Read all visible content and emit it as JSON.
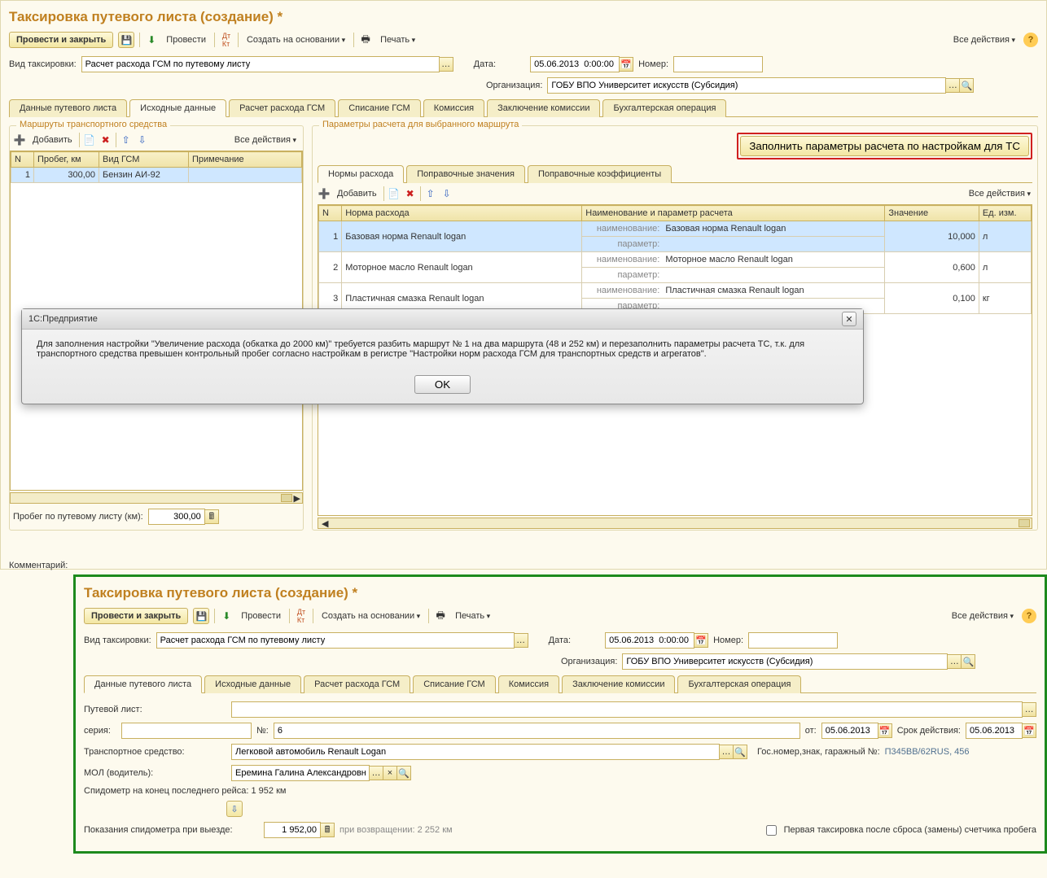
{
  "top": {
    "title": "Таксировка путевого листа (создание) *",
    "toolbar": {
      "post_close": "Провести и закрыть",
      "post": "Провести",
      "create_based": "Создать на основании",
      "print": "Печать",
      "all_actions": "Все действия"
    },
    "fields": {
      "type_label": "Вид таксировки:",
      "type_value": "Расчет расхода ГСМ по путевому листу",
      "date_label": "Дата:",
      "date_value": "05.06.2013  0:00:00",
      "number_label": "Номер:",
      "number_value": "",
      "org_label": "Организация:",
      "org_value": "ГОБУ ВПО Университет искусств (Субсидия)"
    },
    "tabs": [
      "Данные путевого листа",
      "Исходные данные",
      "Расчет расхода ГСМ",
      "Списание ГСМ",
      "Комиссия",
      "Заключение комиссии",
      "Бухгалтерская операция"
    ],
    "active_tab": 1,
    "left_panel": {
      "legend": "Маршруты транспортного средства",
      "toolbar": {
        "add": "Добавить",
        "all_actions": "Все действия"
      },
      "cols": [
        "N",
        "Пробег, км",
        "Вид ГСМ",
        "Примечание"
      ],
      "rows": [
        {
          "n": "1",
          "probeg": "300,00",
          "gsm": "Бензин АИ-92",
          "note": ""
        }
      ]
    },
    "right_panel": {
      "legend": "Параметры расчета для выбранного маршрута",
      "fill_btn": "Заполнить параметры расчета по настройкам для ТС",
      "subtabs": [
        "Нормы расхода",
        "Поправочные значения",
        "Поправочные коэффициенты"
      ],
      "active_subtab": 0,
      "toolbar": {
        "add": "Добавить",
        "all_actions": "Все действия"
      },
      "cols": [
        "N",
        "Норма расхода",
        "Наименование и параметр расчета",
        "Значение",
        "Ед. изм."
      ],
      "rows": [
        {
          "n": "1",
          "norm": "Базовая норма Renault logan",
          "name_lbl": "наименование:",
          "name_val": "Базовая норма Renault logan",
          "param_lbl": "параметр:",
          "param_val": "",
          "value": "10,000",
          "unit": "л"
        },
        {
          "n": "2",
          "norm": "Моторное масло Renault logan",
          "name_lbl": "наименование:",
          "name_val": "Моторное масло Renault logan",
          "param_lbl": "параметр:",
          "param_val": "",
          "value": "0,600",
          "unit": "л"
        },
        {
          "n": "3",
          "norm": "Пластичная смазка Renault logan",
          "name_lbl": "наименование:",
          "name_val": "Пластичная смазка Renault logan",
          "param_lbl": "параметр:",
          "param_val": "",
          "value": "0,100",
          "unit": "кг"
        }
      ]
    },
    "footer": {
      "probeg_label": "Пробег по путевому листу (км):",
      "probeg_value": "300,00"
    },
    "dialog": {
      "title": "1С:Предприятие",
      "text": "Для заполнения настройки \"Увеличение расхода (обкатка до 2000 км)\" требуется разбить маршрут № 1 на два маршрута (48 и 252 км) и перезаполнить параметры расчета ТС, т.к. для транспортного средства превышен контрольный пробег согласно настройкам в регистре \"Настройки норм расхода ГСМ для транспортных средств и агрегатов\".",
      "ok": "OK"
    },
    "comment_label": "Комментарий:"
  },
  "bottom": {
    "title": "Таксировка путевого листа (создание) *",
    "toolbar": {
      "post_close": "Провести и закрыть",
      "post": "Провести",
      "create_based": "Создать на основании",
      "print": "Печать",
      "all_actions": "Все действия"
    },
    "fields": {
      "type_label": "Вид таксировки:",
      "type_value": "Расчет расхода ГСМ по путевому листу",
      "date_label": "Дата:",
      "date_value": "05.06.2013  0:00:00",
      "number_label": "Номер:",
      "number_value": "",
      "org_label": "Организация:",
      "org_value": "ГОБУ ВПО Университет искусств (Субсидия)"
    },
    "tabs": [
      "Данные путевого листа",
      "Исходные данные",
      "Расчет расхода ГСМ",
      "Списание ГСМ",
      "Комиссия",
      "Заключение комиссии",
      "Бухгалтерская операция"
    ],
    "active_tab": 0,
    "waybill": {
      "pl_label": "Путевой лист:",
      "pl_value": "",
      "seria_label": "серия:",
      "seria_value": "",
      "no_label": "№:",
      "no_value": "6",
      "ot_label": "от:",
      "ot_value": "05.06.2013",
      "srok_label": "Срок действия:",
      "srok_value": "05.06.2013",
      "ts_label": "Транспортное средство:",
      "ts_value": "Легковой автомобиль Renault Logan",
      "gos_label": "Гос.номер,знак, гаражный №:",
      "gos_value": "П345ВВ/62RUS, 456",
      "mol_label": "МОЛ (водитель):",
      "mol_value": "Еремина Галина Александровна ",
      "spid_label": "Спидометр на конец последнего рейса: 1 952 км",
      "pokaz_label": "Показания спидометра при выезде:",
      "pokaz_value": "1 952,00",
      "vozvr_label": "при возвращении: 2 252 км",
      "chk_label": "Первая таксировка после сброса (замены) счетчика пробега"
    }
  }
}
